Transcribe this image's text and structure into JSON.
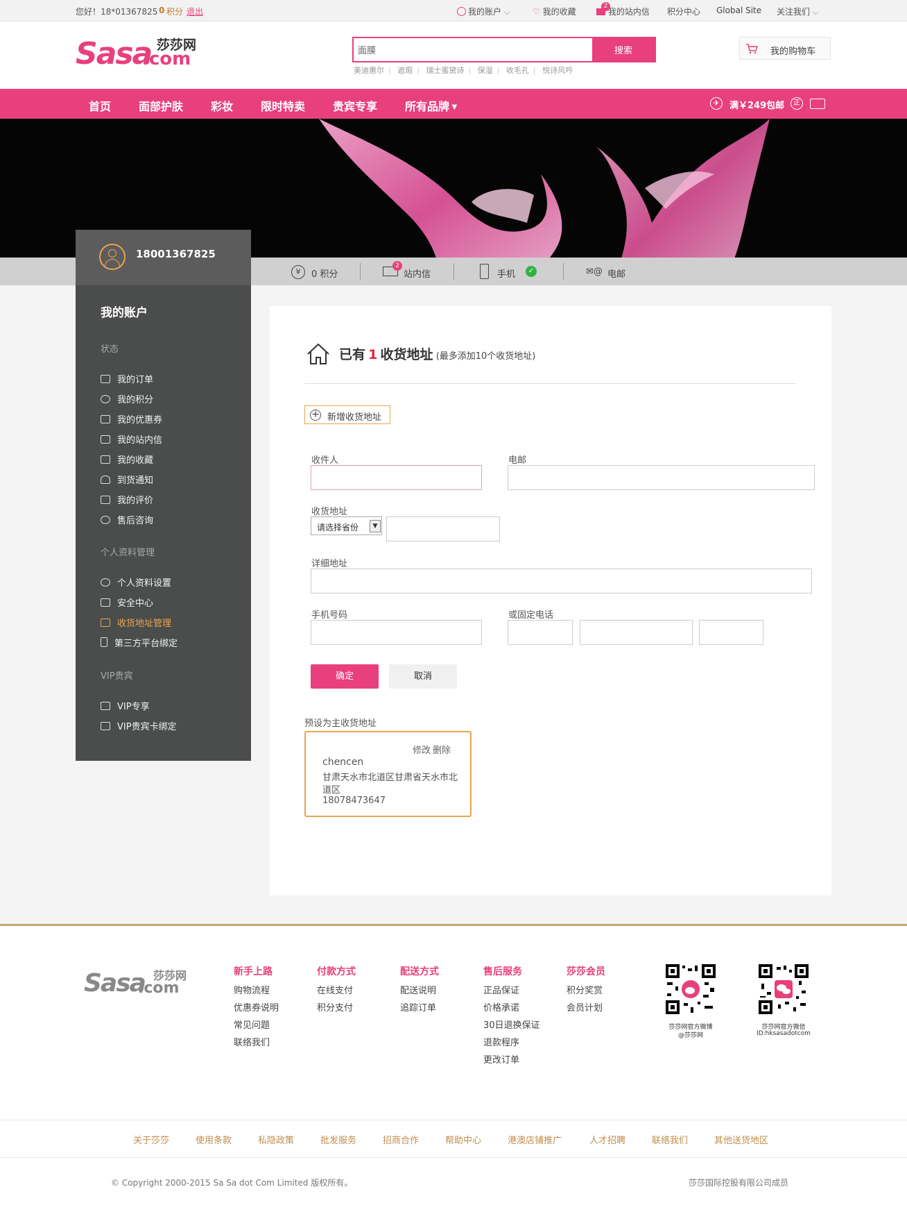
{
  "topbar": {
    "greeting": "您好！18*01367825",
    "points_num": "0",
    "points_label": "积分",
    "logout": "退出",
    "my_account": "我的账户",
    "favorites": "我的收藏",
    "messages": "我的站内信",
    "message_count": "2",
    "points_center": "积分中心",
    "global_site": "Global Site",
    "follow_us": "关注我们"
  },
  "header": {
    "logo_text": "Sasa",
    "logo_dot": ".com",
    "logo_cn": "莎莎网",
    "search_value": "面膜",
    "search_button": "搜索",
    "hot_keywords": [
      "美迪惠尔",
      "遮瑕",
      "瑞士蜜黛诗",
      "保湿",
      "收毛孔",
      "悦诗风吟"
    ],
    "cart_label": "我的购物车"
  },
  "nav": {
    "items": [
      "首页",
      "面部护肤",
      "彩妆",
      "限时特卖",
      "贵宾专享",
      "所有品牌"
    ],
    "promo": "满￥249包邮"
  },
  "account_stats": {
    "points": "0 积分",
    "messages": "站内信",
    "message_count": "2",
    "phone": "手机",
    "email": "电邮"
  },
  "sidebar": {
    "username": "18001367825",
    "title": "我的账户",
    "section_status": "状态",
    "status_items": [
      "我的订单",
      "我的积分",
      "我的优惠券",
      "我的站内信",
      "我的收藏",
      "到货通知",
      "我的评价",
      "售后咨询"
    ],
    "section_profile": "个人资料管理",
    "profile_items": [
      "个人资料设置",
      "安全中心",
      "收货地址管理",
      "第三方平台绑定"
    ],
    "section_vip": "VIP贵宾",
    "vip_items": [
      "VIP专享",
      "VIP贵宾卡绑定"
    ]
  },
  "address": {
    "heading_prefix": "已有",
    "count": "1",
    "heading_suffix": "收货地址",
    "note": "(最多添加10个收货地址)",
    "add_button": "新增收货地址",
    "form": {
      "recipient_label": "收件人",
      "email_label": "电邮",
      "address_label": "收货地址",
      "province_select": "请选择省份",
      "detail_label": "详细地址",
      "mobile_label": "手机号码",
      "landline_label": "或固定电话",
      "confirm": "确定",
      "cancel": "取消"
    },
    "default_label": "预设为主收货地址",
    "card": {
      "edit": "修改",
      "delete": "删除",
      "name": "chencen",
      "line1": "甘肃天水市北道区甘肃省天水市北",
      "line2": "道区",
      "phone": "18078473647"
    }
  },
  "footer": {
    "logo_text": "Sasa",
    "logo_dot": ".com",
    "logo_cn": "莎莎网",
    "columns": [
      {
        "title": "新手上路",
        "links": [
          "购物流程",
          "优惠券说明",
          "常见问题",
          "联络我们"
        ]
      },
      {
        "title": "付款方式",
        "links": [
          "在线支付",
          "积分支付"
        ]
      },
      {
        "title": "配送方式",
        "links": [
          "配送说明",
          "追踪订单"
        ]
      },
      {
        "title": "售后服务",
        "links": [
          "正品保证",
          "价格承诺",
          "30日退换保证",
          "退款程序",
          "更改订单"
        ]
      },
      {
        "title": "莎莎会员",
        "links": [
          "积分奖赏",
          "会员计划"
        ]
      }
    ],
    "qr_weibo_line1": "莎莎网官方微博",
    "qr_weibo_line2": "@莎莎网",
    "qr_wechat_line1": "莎莎网官方微信",
    "qr_wechat_line2": "ID:hksasadotcom",
    "bottom_links": [
      "关于莎莎",
      "使用条款",
      "私隐政策",
      "批发服务",
      "招商合作",
      "帮助中心",
      "港澳店铺推广",
      "人才招聘",
      "联络我们",
      "其他送货地区"
    ],
    "copyright": "© Copyright 2000-2015 Sa Sa dot Com Limited 版权所有。",
    "member": "莎莎国际控股有限公司成员"
  },
  "colors": {
    "brand_pink": "#e8407c",
    "sidebar_bg": "#4a4d4c",
    "accent_orange": "#e8a550",
    "footer_gold": "#c8a675"
  }
}
